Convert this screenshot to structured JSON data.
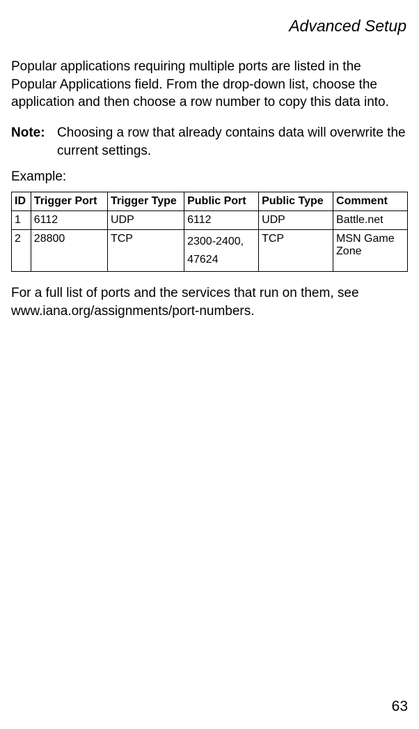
{
  "header": {
    "section_title": "Advanced Setup"
  },
  "body": {
    "intro": "Popular applications requiring multiple ports are listed in the Popular Applications field. From the drop-down list, choose the application and then choose a row number to copy this data into.",
    "note_label": "Note:",
    "note_text": "Choosing a row that already contains data will overwrite the current settings.",
    "example_label": "Example:",
    "outro": "For a full list of ports and the services that run on them, see www.iana.org/assignments/port-numbers."
  },
  "table": {
    "headers": {
      "id": "ID",
      "trigger_port": "Trigger Port",
      "trigger_type": "Trigger Type",
      "public_port": "Public Port",
      "public_type": "Public Type",
      "comment": "Comment"
    },
    "rows": [
      {
        "id": "1",
        "trigger_port": "6112",
        "trigger_type": "UDP",
        "public_port": "6112",
        "public_type": "UDP",
        "comment": " Battle.net"
      },
      {
        "id": "2",
        "trigger_port": "28800",
        "trigger_type": "TCP",
        "public_port": "2300-2400, 47624",
        "public_type": "TCP",
        "comment": "MSN Game Zone"
      }
    ]
  },
  "footer": {
    "page_number": "63"
  },
  "chart_data": {
    "type": "table",
    "title": "Example port triggering table",
    "columns": [
      "ID",
      "Trigger Port",
      "Trigger Type",
      "Public Port",
      "Public Type",
      "Comment"
    ],
    "rows": [
      [
        "1",
        "6112",
        "UDP",
        "6112",
        "UDP",
        "Battle.net"
      ],
      [
        "2",
        "28800",
        "TCP",
        "2300-2400, 47624",
        "TCP",
        "MSN Game Zone"
      ]
    ]
  }
}
